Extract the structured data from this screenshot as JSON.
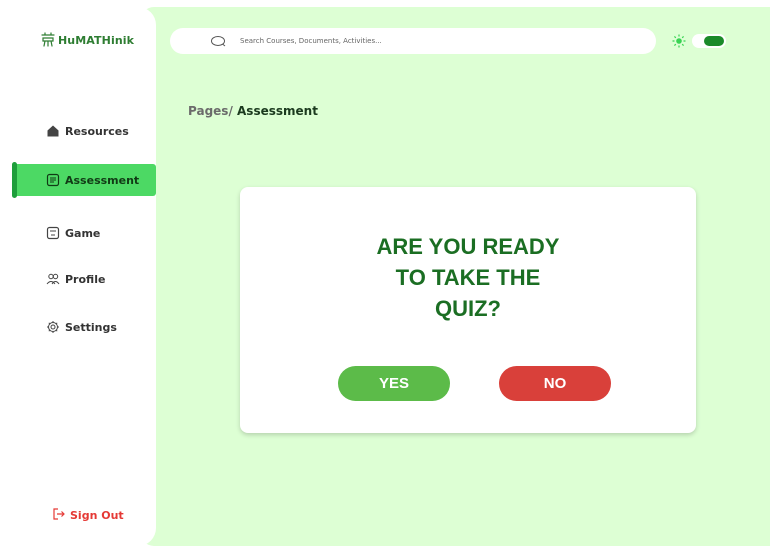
{
  "app": {
    "logo_text": "HuMATHinik"
  },
  "sidebar": {
    "items": [
      {
        "label": "Resources"
      },
      {
        "label": "Assessment"
      },
      {
        "label": "Game"
      },
      {
        "label": "Profile"
      },
      {
        "label": "Settings"
      }
    ],
    "signout_label": "Sign Out"
  },
  "search": {
    "placeholder": "Search Courses, Documents, Activities..."
  },
  "breadcrumb": {
    "parent": "Pages/",
    "current": "Assessment"
  },
  "quiz_prompt": {
    "lines": [
      "ARE YOU READY",
      "TO TAKE THE",
      "QUIZ?"
    ],
    "yes_label": "YES",
    "no_label": "NO"
  },
  "colors": {
    "accent": "#4cd964",
    "background": "#ddffd4",
    "title_green": "#1b6e23",
    "yes_button": "#5cbb49",
    "no_button": "#d9403a"
  }
}
